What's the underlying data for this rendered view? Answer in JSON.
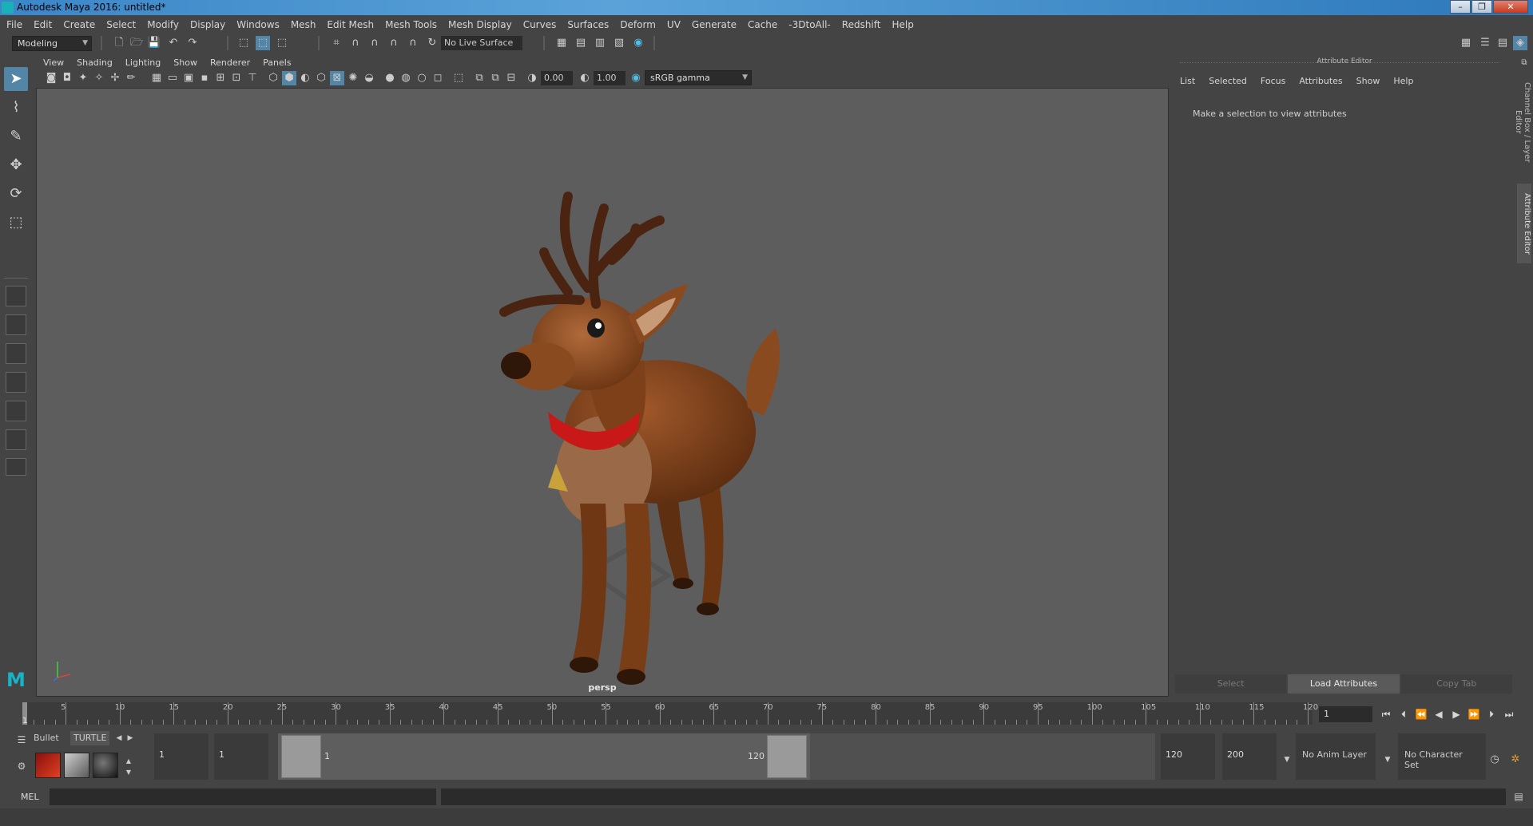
{
  "window": {
    "title": "Autodesk Maya 2016: untitled*"
  },
  "menubar": [
    "File",
    "Edit",
    "Create",
    "Select",
    "Modify",
    "Display",
    "Windows",
    "Mesh",
    "Edit Mesh",
    "Mesh Tools",
    "Mesh Display",
    "Curves",
    "Surfaces",
    "Deform",
    "UV",
    "Generate",
    "Cache",
    "-3DtoAll-",
    "Redshift",
    "Help"
  ],
  "shelf": {
    "mode": "Modeling",
    "live_surface": "No Live Surface"
  },
  "panel": {
    "menus": [
      "View",
      "Shading",
      "Lighting",
      "Show",
      "Renderer",
      "Panels"
    ],
    "exposure": "0.00",
    "gamma": "1.00",
    "colorspace": "sRGB gamma",
    "camera": "persp"
  },
  "attribute_editor": {
    "header": "Attribute Editor",
    "menus": [
      "List",
      "Selected",
      "Focus",
      "Attributes",
      "Show",
      "Help"
    ],
    "message": "Make a selection to view attributes",
    "buttons": [
      "Select",
      "Load Attributes",
      "Copy Tab"
    ]
  },
  "side_tabs": [
    "Channel Box / Layer Editor",
    "Attribute Editor"
  ],
  "timeline": {
    "ticks": [
      "5",
      "10",
      "15",
      "20",
      "25",
      "30",
      "35",
      "40",
      "45",
      "50",
      "55",
      "60",
      "65",
      "70",
      "75",
      "80",
      "85",
      "90",
      "95",
      "100",
      "105",
      "110",
      "115",
      "120"
    ],
    "current_frame_label": "1",
    "current_frame": "1"
  },
  "range": {
    "shelf_tabs": [
      "Bullet",
      "TURTLE"
    ],
    "start_time": "1",
    "playback_start": "1",
    "slider_start": "1",
    "slider_end": "120",
    "playback_end": "120",
    "end_time": "200",
    "anim_layer": "No Anim Layer",
    "character_set": "No Character Set"
  },
  "cmdline": {
    "label": "MEL"
  }
}
